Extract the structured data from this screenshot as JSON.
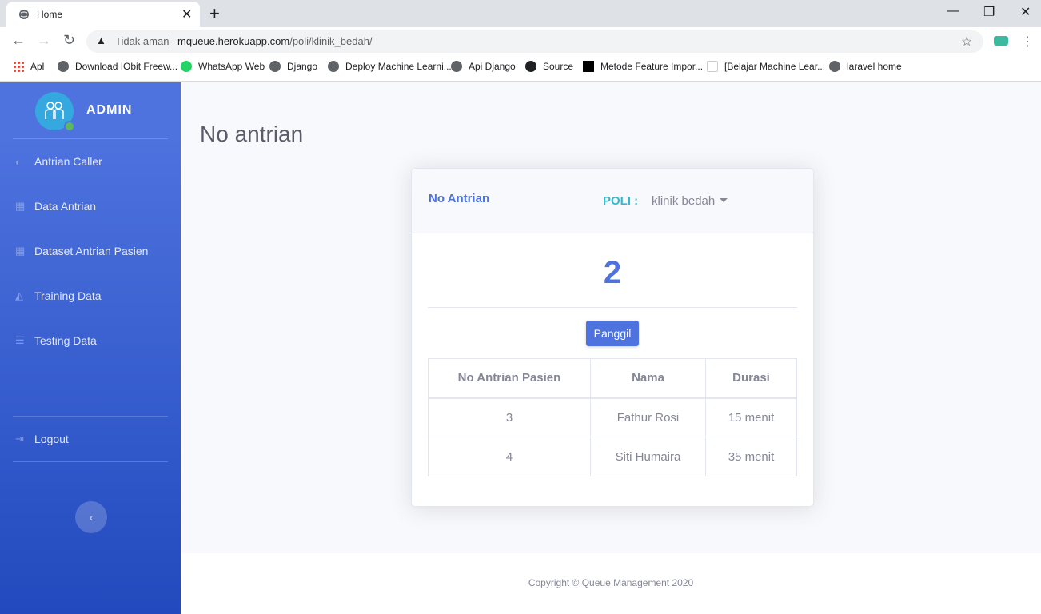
{
  "browser": {
    "tab_title": "Home",
    "security_text": "Tidak aman",
    "url_host": "mqueue.herokuapp.com",
    "url_path": "/poli/klinik_bedah/",
    "bookmarks": [
      {
        "label": "Apl",
        "icon": "apps-grid-icon"
      },
      {
        "label": "Download IObit Freew...",
        "icon": "globe-icon"
      },
      {
        "label": "WhatsApp Web",
        "icon": "whatsapp-icon"
      },
      {
        "label": "Django",
        "icon": "globe-icon"
      },
      {
        "label": "Deploy Machine Learni...",
        "icon": "globe-icon"
      },
      {
        "label": "Api Django",
        "icon": "globe-icon"
      },
      {
        "label": "Source",
        "icon": "github-icon"
      },
      {
        "label": "Metode Feature Impor...",
        "icon": "medium-icon"
      },
      {
        "label": "[Belajar Machine Lear...",
        "icon": "youtube-icon"
      },
      {
        "label": "laravel home",
        "icon": "globe-icon"
      }
    ]
  },
  "sidebar": {
    "brand": "ADMIN",
    "items": [
      {
        "label": "Antrian Caller",
        "icon": "tachometer-icon"
      },
      {
        "label": "Data Antrian",
        "icon": "table-icon"
      },
      {
        "label": "Dataset Antrian Pasien",
        "icon": "table-icon"
      },
      {
        "label": "Training Data",
        "icon": "area-chart-icon"
      },
      {
        "label": "Testing Data",
        "icon": "list-icon"
      }
    ],
    "logout": {
      "label": "Logout",
      "icon": "sign-out-icon"
    }
  },
  "main": {
    "page_title": "No antrian",
    "card": {
      "title": "No Antrian",
      "poli_label": "POLI :",
      "poli_selected": "klinik bedah",
      "current_number": "2",
      "call_button": "Panggil",
      "table": {
        "headers": [
          "No Antrian Pasien",
          "Nama",
          "Durasi"
        ],
        "rows": [
          [
            "3",
            "Fathur Rosi",
            "15 menit"
          ],
          [
            "4",
            "Siti Humaira",
            "35 menit"
          ]
        ]
      }
    }
  },
  "footer": {
    "copyright": "Copyright © Queue Management 2020"
  },
  "colors": {
    "primary": "#4e73df",
    "info": "#36b9cc",
    "text_muted": "#858796",
    "background": "#f8f9fc"
  }
}
